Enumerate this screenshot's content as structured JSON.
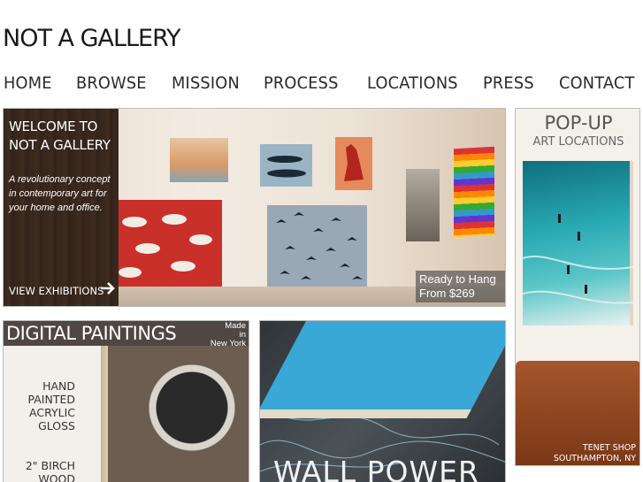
{
  "site": {
    "title": "NOT A GALLERY"
  },
  "nav": [
    {
      "label": "HOME"
    },
    {
      "label": "BROWSE"
    },
    {
      "label": "MISSION"
    },
    {
      "label": "PROCESS"
    },
    {
      "label": "LOCATIONS"
    },
    {
      "label": "PRESS"
    },
    {
      "label": "CONTACT"
    }
  ],
  "hero": {
    "title_line1": "WELCOME TO",
    "title_line2": "NOT A GALLERY",
    "description": "A revolutionary concept in contemporary art for your home and office.",
    "link_label": "VIEW EXHIBITIONS",
    "price_line1": "Ready to Hang",
    "price_line2": "From $269"
  },
  "digital": {
    "title": "DIGITAL PAINTINGS",
    "made_in_1": "Made",
    "made_in_2": "in",
    "made_in_3": "New York",
    "specs": [
      "HAND",
      "PAINTED",
      "ACRYLIC",
      "GLOSS"
    ],
    "specs2": [
      "2\" BIRCH",
      "WOOD"
    ]
  },
  "wall": {
    "title": "WALL POWER"
  },
  "popup": {
    "title": "POP-UP",
    "subtitle": "ART LOCATIONS",
    "shop_line1": "TENET SHOP",
    "shop_line2": "SOUTHAMPTON, NY"
  }
}
